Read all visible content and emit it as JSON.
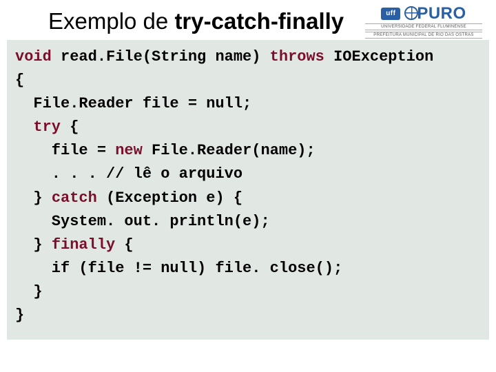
{
  "header": {
    "title_plain": "Exemplo de ",
    "title_bold": "try-catch-finally"
  },
  "logo": {
    "badge": "uff",
    "name": "PURO",
    "sub1": "UNIVERSIDADE FEDERAL FLUMINENSE",
    "sub2": "PREFEITURA MUNICIPAL DE RIO DAS OSTRAS"
  },
  "code": {
    "l1a": "void",
    "l1b": " read.File(String name) ",
    "l1c": "throws",
    "l1d": " IOException",
    "l2": "{",
    "l3": "  File.Reader file = null;",
    "l4a": "  ",
    "l4b": "try",
    "l4c": " {",
    "l5a": "    file = ",
    "l5b": "new",
    "l5c": " File.Reader(name);",
    "l6": "    . . . // lê o arquivo",
    "l7a": "  } ",
    "l7b": "catch",
    "l7c": " (Exception e) {",
    "l8": "    System. out. println(e);",
    "l9a": "  } ",
    "l9b": "finally",
    "l9c": " {",
    "l10": "    if (file != null) file. close();",
    "l11": "  }",
    "l12": "}"
  }
}
